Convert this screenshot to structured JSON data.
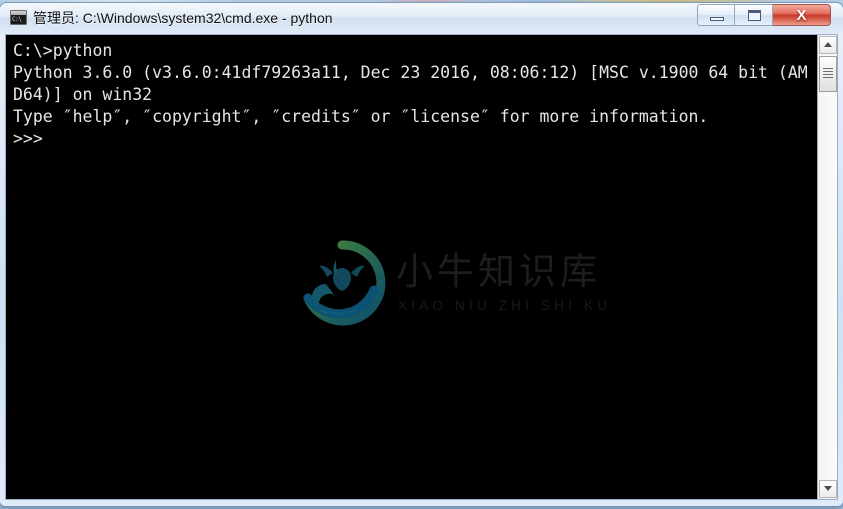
{
  "window": {
    "title": "管理员: C:\\Windows\\system32\\cmd.exe - python",
    "icon_name": "cmd-console-icon",
    "icon_prompt_text": "C:\\",
    "controls": {
      "minimize_label": "",
      "maximize_label": "",
      "close_label": "X"
    }
  },
  "console": {
    "lines": [
      "C:\\>python",
      "Python 3.6.0 (v3.6.0:41df79263a11, Dec 23 2016, 08:06:12) [MSC v.1900 64 bit (AM",
      "D64)] on win32",
      "Type ″help″, ″copyright″, ″credits″ or ″license″ for more information.",
      ">>>"
    ],
    "text": "C:\\>python\nPython 3.6.0 (v3.6.0:41df79263a11, Dec 23 2016, 08:06:12) [MSC v.1900 64 bit (AM\nD64)] on win32\nType ″help″, ″copyright″, ″credits″ or ″license″ for more information.\n>>>",
    "prompt": ">>>",
    "foreground_color": "#e6e6e6",
    "background_color": "#000000"
  },
  "scrollbar": {
    "up_arrow": "▲",
    "down_arrow": "▼",
    "orientation": "vertical"
  },
  "watermark": {
    "chinese": "小牛知识库",
    "pinyin": "XIAO NIU ZHI SHI KU",
    "logo_name": "bull-head-circle-logo",
    "color_green": "#3d7a30",
    "color_teal": "#0d5273"
  }
}
